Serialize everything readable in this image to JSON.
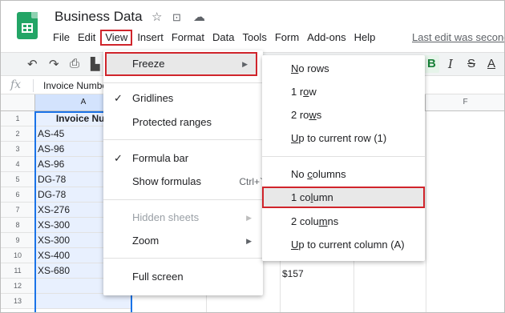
{
  "header": {
    "title": "Business Data",
    "star_icon": "☆",
    "folder_icon": "⊡",
    "cloud_icon": "☁",
    "last_edit": "Last edit was second"
  },
  "menubar": [
    "File",
    "Edit",
    "View",
    "Insert",
    "Format",
    "Data",
    "Tools",
    "Form",
    "Add-ons",
    "Help"
  ],
  "toolbar": {
    "undo": "↶",
    "redo": "↷",
    "print": "⎙",
    "paint": "▙",
    "bold": "B",
    "italic": "I",
    "strike": "S",
    "text_color": "A"
  },
  "formula_bar": {
    "fx": "fx",
    "value": "Invoice Number"
  },
  "grid": {
    "columns": [
      "A",
      "",
      "",
      "",
      "F"
    ],
    "rows": [
      "1",
      "2",
      "3",
      "4",
      "5",
      "6",
      "7",
      "8",
      "9",
      "10",
      "11",
      "12",
      "13"
    ],
    "column_a": [
      "Invoice Num",
      "AS-45",
      "AS-96",
      "AS-96",
      "DG-78",
      "DG-78",
      "XS-276",
      "XS-300",
      "XS-300",
      "XS-400",
      "XS-680",
      "",
      ""
    ],
    "visible_d_value": "$157"
  },
  "view_menu": {
    "freeze": "Freeze",
    "gridlines": "Gridlines",
    "protected_ranges": "Protected ranges",
    "formula_bar": "Formula bar",
    "show_formulas": "Show formulas",
    "show_formulas_shortcut": "Ctrl+`",
    "hidden_sheets": "Hidden sheets",
    "zoom": "Zoom",
    "full_screen": "Full screen",
    "check": "✓",
    "arrow": "▶"
  },
  "freeze_menu": {
    "no_rows_a": "N",
    "no_rows_b": "o rows",
    "one_row_a": "1 r",
    "one_row_b": "o",
    "one_row_c": "w",
    "two_rows_a": "2 ro",
    "two_rows_b": "w",
    "two_rows_c": "s",
    "up_row_a": "U",
    "up_row_b": "p to current row (1)",
    "no_cols_a": "No ",
    "no_cols_b": "c",
    "no_cols_c": "olumns",
    "one_col_a": "1 co",
    "one_col_b": "l",
    "one_col_c": "umn",
    "two_cols_a": "2 colu",
    "two_cols_b": "m",
    "two_cols_c": "ns",
    "up_col_a": "U",
    "up_col_b": "p to current column (A)"
  }
}
